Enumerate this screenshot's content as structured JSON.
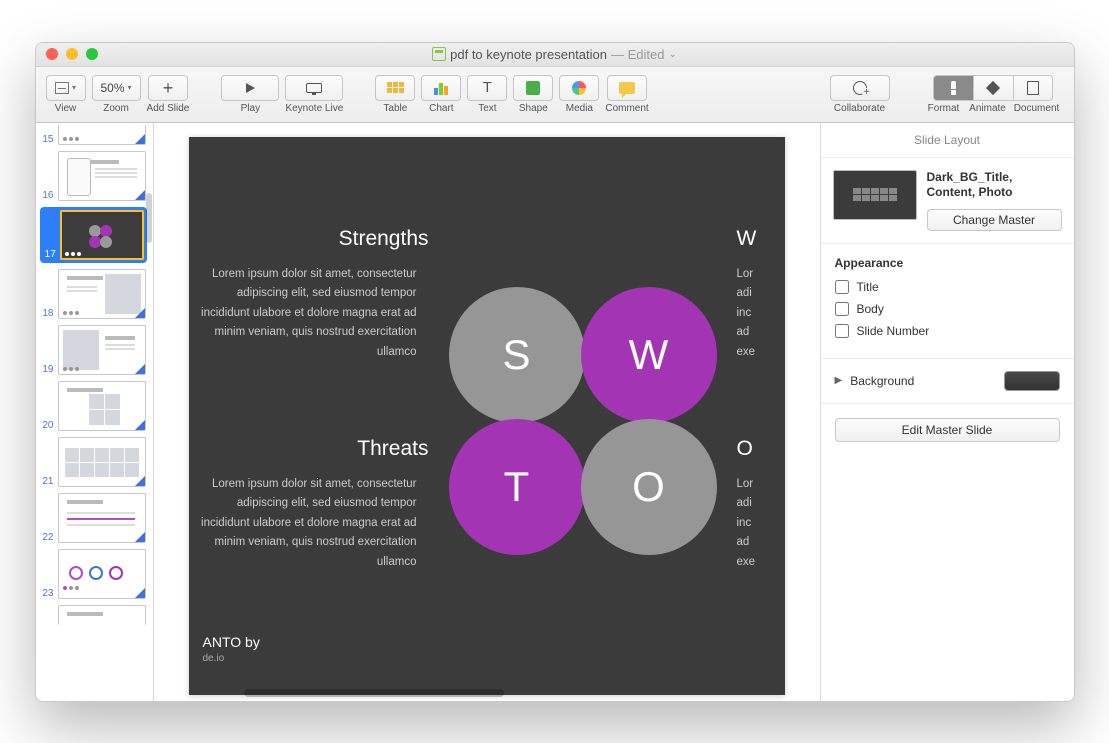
{
  "window": {
    "title": "pdf to keynote presentation",
    "edited": "— Edited",
    "chevron": "⌄"
  },
  "toolbar": {
    "view": "View",
    "zoom": "Zoom",
    "zoom_val": "50%",
    "add_slide": "Add Slide",
    "play": "Play",
    "keynote_live": "Keynote Live",
    "table": "Table",
    "chart": "Chart",
    "text": "Text",
    "shape": "Shape",
    "media": "Media",
    "comment": "Comment",
    "collaborate": "Collaborate",
    "format": "Format",
    "animate": "Animate",
    "document": "Document"
  },
  "thumbs": [
    {
      "n": "15"
    },
    {
      "n": "16"
    },
    {
      "n": "17",
      "sel": true
    },
    {
      "n": "18"
    },
    {
      "n": "19"
    },
    {
      "n": "20"
    },
    {
      "n": "21"
    },
    {
      "n": "22"
    },
    {
      "n": "23"
    }
  ],
  "slide": {
    "strengths": {
      "title": "Strengths",
      "body": "Lorem ipsum dolor sit amet, consectetur adipiscing elit, sed eiusmod tempor incididunt ulabore et dolore magna erat ad minim veniam, quis nostrud exercitation ullamco"
    },
    "threats": {
      "title": "Threats",
      "body": "Lorem ipsum dolor sit amet, consectetur adipiscing elit, sed eiusmod tempor incididunt ulabore et dolore magna erat ad minim veniam, quis nostrud exercitation ullamco"
    },
    "weaknesses": {
      "title": "W",
      "body": "Lor\nadi\ninc\nad\nexe"
    },
    "opportunities": {
      "title": "O",
      "body": "Lor\nadi\ninc\nad\nexe"
    },
    "circles": {
      "s": "S",
      "w": "W",
      "t": "T",
      "o": "O"
    },
    "footer_line1": "ANTO by",
    "footer_line2": "de.io"
  },
  "inspector": {
    "header": "Slide Layout",
    "master_name": "Dark_BG_Title, Content, Photo",
    "change_master": "Change Master",
    "appearance": "Appearance",
    "chk_title": "Title",
    "chk_body": "Body",
    "chk_slidenum": "Slide Number",
    "background": "Background",
    "edit_master": "Edit Master Slide"
  }
}
